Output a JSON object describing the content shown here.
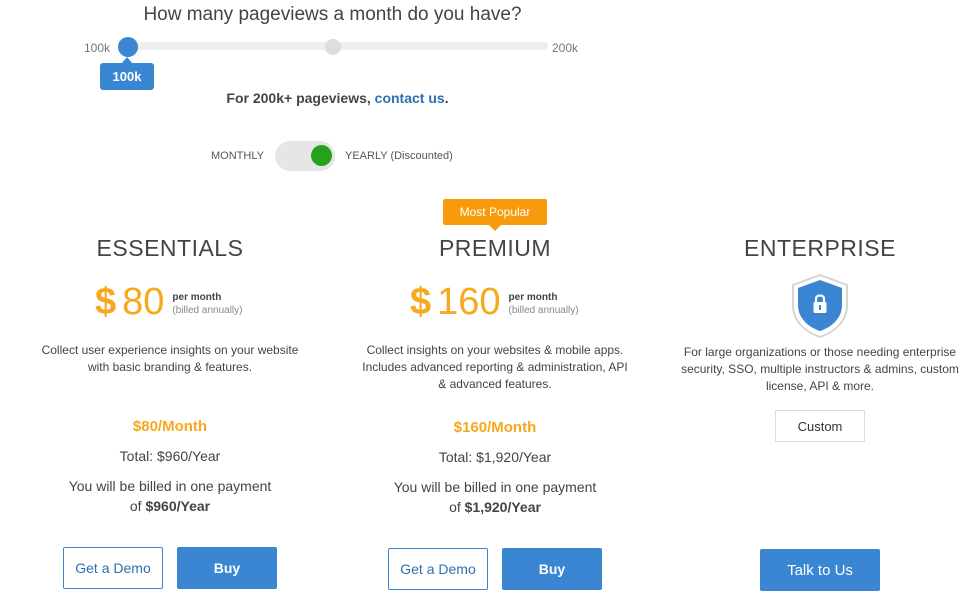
{
  "slider": {
    "question": "How many pageviews a month do you have?",
    "min_label": "100k",
    "max_label": "200k",
    "value_label": "100k",
    "contact_text": "For 200k+ pageviews,",
    "contact_link": "contact us",
    "contact_suffix": "."
  },
  "billing_toggle": {
    "monthly_label": "MONTHLY",
    "yearly_label": "YEARLY (Discounted)",
    "selected": "yearly",
    "active_color": "#27a01a"
  },
  "plans": [
    {
      "title": "ESSENTIALS",
      "currency": "$",
      "price": "80",
      "per_month": "per month",
      "billed_annually": "(billed annually)",
      "desc": [
        "Collect user experience insights on your website",
        "with basic branding & features."
      ],
      "month_price": "$80/Month",
      "total": "Total: $960/Year",
      "billed_prefix": "You will be billed in one payment",
      "billed_of": "of",
      "billed_amount": "$960/Year",
      "demo_label": "Get a Demo",
      "buy_label": "Buy"
    },
    {
      "title": "PREMIUM",
      "badge": "Most Popular",
      "currency": "$",
      "price": "160",
      "per_month": "per month",
      "billed_annually": "(billed annually)",
      "desc": [
        "Collect insights on your websites & mobile apps.",
        "Includes advanced reporting & administration, API",
        "& advanced features."
      ],
      "month_price": "$160/Month",
      "total": "Total: $1,920/Year",
      "billed_prefix": "You will be billed in one payment",
      "billed_of": "of",
      "billed_amount": "$1,920/Year",
      "demo_label": "Get a Demo",
      "buy_label": "Buy"
    },
    {
      "title": "ENTERPRISE",
      "icon": "shield-lock-icon",
      "desc": [
        "For large organizations or those needing enterprise",
        "security, SSO, multiple instructors & admins, custom",
        "license, API & more."
      ],
      "custom_label": "Custom",
      "talk_label": "Talk to Us"
    }
  ],
  "colors": {
    "accent_blue": "#3b86d2",
    "price_orange": "#f7a81c",
    "badge_orange": "#f79a0b"
  }
}
